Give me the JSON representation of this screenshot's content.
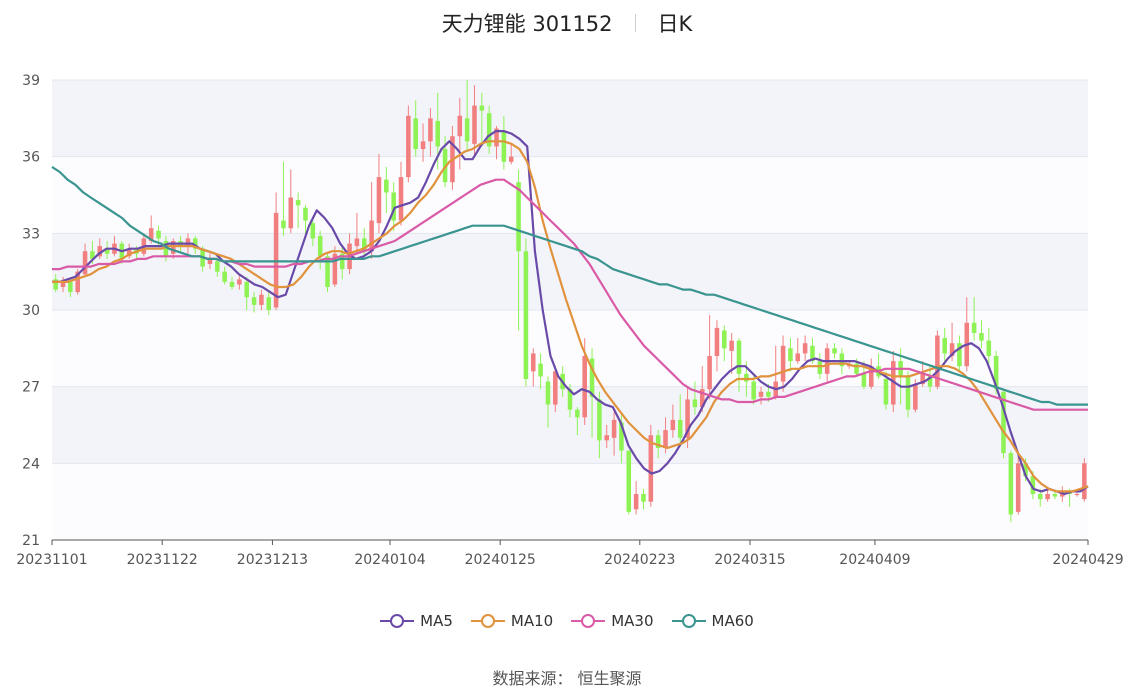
{
  "header": {
    "title": "天力锂能 301152",
    "period": "日K"
  },
  "footer": {
    "source": "数据来源：  恒生聚源"
  },
  "colors": {
    "up": "#f27f7f",
    "down": "#8ef255",
    "ma5": "#6a4aa8",
    "ma10": "#e0923c",
    "ma30": "#d95aa6",
    "ma60": "#3a9490",
    "band": "#f3f4fa",
    "grid": "#e4e6ef"
  },
  "chart_data": {
    "type": "candlestick",
    "ylim": [
      21,
      39
    ],
    "yticks": [
      "21",
      "24",
      "27",
      "30",
      "33",
      "36",
      "39"
    ],
    "xticks": [
      "20231101",
      "20231122",
      "20231213",
      "20240104",
      "20240125",
      "20240223",
      "20240315",
      "20240409",
      "20240429"
    ],
    "legend": [
      "MA5",
      "MA10",
      "MA30",
      "MA60"
    ],
    "grid": true,
    "legend_position": "bottom",
    "candles": [
      [
        31.2,
        30.8,
        31.4,
        30.7
      ],
      [
        30.9,
        31.1,
        31.3,
        30.7
      ],
      [
        31.1,
        30.7,
        31.2,
        30.5
      ],
      [
        30.7,
        31.5,
        31.6,
        30.6
      ],
      [
        31.4,
        32.3,
        32.6,
        31.3
      ],
      [
        32.3,
        32.0,
        32.7,
        31.8
      ],
      [
        32.1,
        32.5,
        32.8,
        32.0
      ],
      [
        32.4,
        32.2,
        32.7,
        32.0
      ],
      [
        32.2,
        32.6,
        32.9,
        32.1
      ],
      [
        32.6,
        32.0,
        32.7,
        31.8
      ],
      [
        32.1,
        32.4,
        32.6,
        32.0
      ],
      [
        32.4,
        32.2,
        32.5,
        32.0
      ],
      [
        32.2,
        32.8,
        33.0,
        32.1
      ],
      [
        32.7,
        33.2,
        33.7,
        32.6
      ],
      [
        33.1,
        32.8,
        33.3,
        32.5
      ],
      [
        32.7,
        32.1,
        32.9,
        31.9
      ],
      [
        32.2,
        32.7,
        32.8,
        32.0
      ],
      [
        32.7,
        32.5,
        32.9,
        32.3
      ],
      [
        32.5,
        32.8,
        33.0,
        32.2
      ],
      [
        32.8,
        32.4,
        32.9,
        32.2
      ],
      [
        32.4,
        31.7,
        32.5,
        31.5
      ],
      [
        31.8,
        32.0,
        32.2,
        31.6
      ],
      [
        31.9,
        31.5,
        32.1,
        31.3
      ],
      [
        31.5,
        31.1,
        31.7,
        31.0
      ],
      [
        31.1,
        30.9,
        31.3,
        30.8
      ],
      [
        31.0,
        31.2,
        31.4,
        30.8
      ],
      [
        31.1,
        30.5,
        31.3,
        30.0
      ],
      [
        30.5,
        30.2,
        30.7,
        29.9
      ],
      [
        30.2,
        30.6,
        30.8,
        30.0
      ],
      [
        30.5,
        30.0,
        30.7,
        29.8
      ],
      [
        30.1,
        33.8,
        34.6,
        30.0
      ],
      [
        33.5,
        33.2,
        35.8,
        32.9
      ],
      [
        33.2,
        34.4,
        35.5,
        33.0
      ],
      [
        34.3,
        34.1,
        34.6,
        33.2
      ],
      [
        34.0,
        33.5,
        34.1,
        32.8
      ],
      [
        33.4,
        32.8,
        33.5,
        32.5
      ],
      [
        32.9,
        32.1,
        33.1,
        31.6
      ],
      [
        32.1,
        30.9,
        32.2,
        30.7
      ],
      [
        31.0,
        32.2,
        32.5,
        30.9
      ],
      [
        32.2,
        31.6,
        32.5,
        31.2
      ],
      [
        31.6,
        32.6,
        33.0,
        31.4
      ],
      [
        32.5,
        32.8,
        33.8,
        32.2
      ],
      [
        32.8,
        32.3,
        33.2,
        32.1
      ],
      [
        32.3,
        33.5,
        35.0,
        32.0
      ],
      [
        33.4,
        35.2,
        36.1,
        33.0
      ],
      [
        35.1,
        34.6,
        35.6,
        33.8
      ],
      [
        34.6,
        33.5,
        35.0,
        33.1
      ],
      [
        33.5,
        35.2,
        35.8,
        33.3
      ],
      [
        35.2,
        37.6,
        38.0,
        35.0
      ],
      [
        37.5,
        36.3,
        38.2,
        36.0
      ],
      [
        36.3,
        36.6,
        37.3,
        35.8
      ],
      [
        36.6,
        37.5,
        37.9,
        36.0
      ],
      [
        37.4,
        36.4,
        38.5,
        35.5
      ],
      [
        36.3,
        35.0,
        36.8,
        34.8
      ],
      [
        35.0,
        36.8,
        37.2,
        34.7
      ],
      [
        36.8,
        37.6,
        38.3,
        35.5
      ],
      [
        37.5,
        36.6,
        39.0,
        36.2
      ],
      [
        36.5,
        38.0,
        38.8,
        36.0
      ],
      [
        38.0,
        37.8,
        38.5,
        36.5
      ],
      [
        37.7,
        36.4,
        38.0,
        36.1
      ],
      [
        36.4,
        37.1,
        37.2,
        35.9
      ],
      [
        37.0,
        35.8,
        37.6,
        35.5
      ],
      [
        35.8,
        36.0,
        36.5,
        35.7
      ],
      [
        35.0,
        32.3,
        35.5,
        29.2
      ],
      [
        32.3,
        27.3,
        32.8,
        27.0
      ],
      [
        27.6,
        28.3,
        28.5,
        27.0
      ],
      [
        27.9,
        27.4,
        28.3,
        26.9
      ],
      [
        27.2,
        26.3,
        27.4,
        25.4
      ],
      [
        26.3,
        27.6,
        27.8,
        26.0
      ],
      [
        27.5,
        26.9,
        27.8,
        26.6
      ],
      [
        26.9,
        26.1,
        27.1,
        25.8
      ],
      [
        26.1,
        25.8,
        26.2,
        25.1
      ],
      [
        25.8,
        28.2,
        28.9,
        25.5
      ],
      [
        28.1,
        26.6,
        28.5,
        25.0
      ],
      [
        26.5,
        24.9,
        26.8,
        24.2
      ],
      [
        24.9,
        25.1,
        25.5,
        24.6
      ],
      [
        25.0,
        25.7,
        26.0,
        24.3
      ],
      [
        25.6,
        24.5,
        25.9,
        24.0
      ],
      [
        24.5,
        22.1,
        24.5,
        22.0
      ],
      [
        22.2,
        22.8,
        23.3,
        22.0
      ],
      [
        22.8,
        22.5,
        23.0,
        22.2
      ],
      [
        22.5,
        25.1,
        25.5,
        22.3
      ],
      [
        25.1,
        24.6,
        25.3,
        24.2
      ],
      [
        24.6,
        25.3,
        25.8,
        24.4
      ],
      [
        25.3,
        25.7,
        26.3,
        25.0
      ],
      [
        25.7,
        25.0,
        26.7,
        24.8
      ],
      [
        25.0,
        26.5,
        27.0,
        24.6
      ],
      [
        26.5,
        26.2,
        27.2,
        25.9
      ],
      [
        26.2,
        26.9,
        27.8,
        26.0
      ],
      [
        26.9,
        28.2,
        29.8,
        26.5
      ],
      [
        28.2,
        29.3,
        29.6,
        27.6
      ],
      [
        29.2,
        28.5,
        29.4,
        28.0
      ],
      [
        28.4,
        28.8,
        29.1,
        27.5
      ],
      [
        28.8,
        27.5,
        28.9,
        26.8
      ],
      [
        27.5,
        27.2,
        28.0,
        26.6
      ],
      [
        27.2,
        26.5,
        27.4,
        26.3
      ],
      [
        26.6,
        26.8,
        27.0,
        26.3
      ],
      [
        26.8,
        26.6,
        27.1,
        26.4
      ],
      [
        26.6,
        27.2,
        28.6,
        26.5
      ],
      [
        27.2,
        28.6,
        29.0,
        26.8
      ],
      [
        28.5,
        28.0,
        28.9,
        27.6
      ],
      [
        28.0,
        28.3,
        28.9,
        27.9
      ],
      [
        28.3,
        28.7,
        29.0,
        28.0
      ],
      [
        28.6,
        28.0,
        28.9,
        27.9
      ],
      [
        28.0,
        27.5,
        28.3,
        27.3
      ],
      [
        27.5,
        28.5,
        28.7,
        27.2
      ],
      [
        28.5,
        28.3,
        28.7,
        28.1
      ],
      [
        28.3,
        27.8,
        28.5,
        27.5
      ],
      [
        27.8,
        27.9,
        28.0,
        27.7
      ],
      [
        27.9,
        27.5,
        28.1,
        27.4
      ],
      [
        27.5,
        27.0,
        28.0,
        26.9
      ],
      [
        27.0,
        27.8,
        28.1,
        26.9
      ],
      [
        27.8,
        27.4,
        28.3,
        27.3
      ],
      [
        27.3,
        26.3,
        27.6,
        26.1
      ],
      [
        26.3,
        28.0,
        28.4,
        26.0
      ],
      [
        28.0,
        27.4,
        28.5,
        26.3
      ],
      [
        27.4,
        26.1,
        27.6,
        25.8
      ],
      [
        26.1,
        27.1,
        27.3,
        26.0
      ],
      [
        27.1,
        27.5,
        28.0,
        27.0
      ],
      [
        27.4,
        27.0,
        27.8,
        26.8
      ],
      [
        27.0,
        29.0,
        29.2,
        26.9
      ],
      [
        28.9,
        28.3,
        29.3,
        28.0
      ],
      [
        28.2,
        28.7,
        29.5,
        28.0
      ],
      [
        28.7,
        27.8,
        29.0,
        27.6
      ],
      [
        27.8,
        29.5,
        30.5,
        27.6
      ],
      [
        29.5,
        29.1,
        30.5,
        28.8
      ],
      [
        29.1,
        28.8,
        29.6,
        28.5
      ],
      [
        28.8,
        28.2,
        29.3,
        27.9
      ],
      [
        28.2,
        26.9,
        28.4,
        26.7
      ],
      [
        26.8,
        24.4,
        26.9,
        24.2
      ],
      [
        24.4,
        22.0,
        24.5,
        21.7
      ],
      [
        22.1,
        24.0,
        24.3,
        22.0
      ],
      [
        24.0,
        23.5,
        24.2,
        23.3
      ],
      [
        23.5,
        22.8,
        23.7,
        22.6
      ],
      [
        22.8,
        22.6,
        23.0,
        22.3
      ],
      [
        22.6,
        22.8,
        23.0,
        22.5
      ],
      [
        22.8,
        22.7,
        22.9,
        22.6
      ],
      [
        22.7,
        22.9,
        23.1,
        22.5
      ],
      [
        22.9,
        22.8,
        23.0,
        22.3
      ],
      [
        22.8,
        22.8,
        23.0,
        22.7
      ],
      [
        22.6,
        24.0,
        24.2,
        22.5
      ]
    ],
    "series": [
      {
        "name": "MA5",
        "values": [
          31.1,
          31.1,
          31.2,
          31.3,
          31.6,
          31.9,
          32.2,
          32.4,
          32.4,
          32.3,
          32.4,
          32.4,
          32.5,
          32.5,
          32.5,
          32.6,
          32.6,
          32.6,
          32.6,
          32.4,
          32.3,
          32.2,
          31.9,
          31.7,
          31.4,
          31.2,
          31.0,
          30.9,
          30.7,
          30.5,
          30.6,
          31.5,
          32.4,
          33.3,
          33.9,
          33.6,
          33.2,
          32.6,
          32.2,
          32.0,
          32.1,
          32.3,
          32.7,
          33.3,
          34.0,
          34.1,
          34.2,
          34.4,
          35.0,
          35.7,
          36.3,
          36.6,
          36.3,
          35.9,
          35.9,
          36.4,
          36.8,
          37.0,
          37.0,
          36.9,
          36.7,
          36.4,
          32.3,
          30.0,
          28.2,
          27.4,
          27.0,
          26.7,
          26.9,
          26.8,
          26.5,
          26.3,
          26.2,
          25.6,
          24.7,
          24.2,
          23.8,
          23.6,
          23.7,
          24.0,
          24.4,
          24.9,
          25.5,
          25.9,
          26.5,
          26.9,
          27.3,
          27.6,
          27.8,
          27.8,
          27.5,
          27.2,
          27.0,
          26.9,
          27.0,
          27.3,
          27.7,
          28.0,
          28.1,
          28.0,
          28.0,
          28.0,
          28.0,
          28.0,
          27.9,
          27.8,
          27.6,
          27.4,
          27.2,
          27.0,
          27.0,
          27.1,
          27.2,
          27.4,
          27.7,
          28.1,
          28.4,
          28.6,
          28.7,
          28.5,
          28.0,
          27.2,
          26.3,
          25.3,
          24.4,
          23.5,
          23.0,
          22.9,
          23.0,
          22.9,
          22.8,
          22.9,
          22.9,
          23.1
        ]
      },
      {
        "name": "MA10",
        "values": [
          31.1,
          31.1,
          31.1,
          31.2,
          31.3,
          31.4,
          31.6,
          31.7,
          31.9,
          32.0,
          32.2,
          32.3,
          32.4,
          32.4,
          32.4,
          32.5,
          32.5,
          32.5,
          32.5,
          32.4,
          32.3,
          32.2,
          32.1,
          32.0,
          31.8,
          31.6,
          31.4,
          31.2,
          31.0,
          30.9,
          30.9,
          31.0,
          31.3,
          31.7,
          32.0,
          32.2,
          32.3,
          32.3,
          32.2,
          32.3,
          32.4,
          32.6,
          32.8,
          33.0,
          33.3,
          33.5,
          33.8,
          34.2,
          34.5,
          34.9,
          35.4,
          35.8,
          36.0,
          36.2,
          36.3,
          36.5,
          36.6,
          36.6,
          36.6,
          36.5,
          36.3,
          35.8,
          34.8,
          33.5,
          32.4,
          31.4,
          30.4,
          29.5,
          28.6,
          27.9,
          27.3,
          26.8,
          26.4,
          26.0,
          25.6,
          25.3,
          25.0,
          24.8,
          24.7,
          24.6,
          24.7,
          24.8,
          25.0,
          25.4,
          25.8,
          26.4,
          26.8,
          27.1,
          27.3,
          27.3,
          27.3,
          27.4,
          27.4,
          27.5,
          27.6,
          27.7,
          27.7,
          27.8,
          27.8,
          27.8,
          27.9,
          27.9,
          27.9,
          27.8,
          27.8,
          27.7,
          27.6,
          27.5,
          27.4,
          27.4,
          27.4,
          27.5,
          27.6,
          27.7,
          27.8,
          27.8,
          27.7,
          27.5,
          27.2,
          26.8,
          26.3,
          25.8,
          25.3,
          24.9,
          24.4,
          24.0,
          23.5,
          23.2,
          23.0,
          22.9,
          22.9,
          22.9,
          23.0,
          23.1
        ]
      },
      {
        "name": "MA30",
        "values": [
          31.6,
          31.6,
          31.7,
          31.7,
          31.7,
          31.7,
          31.8,
          31.8,
          31.8,
          31.9,
          31.9,
          32.0,
          32.0,
          32.1,
          32.1,
          32.1,
          32.1,
          32.1,
          32.1,
          32.1,
          32.0,
          32.0,
          31.9,
          31.9,
          31.8,
          31.8,
          31.7,
          31.7,
          31.7,
          31.7,
          31.7,
          31.8,
          31.8,
          31.9,
          31.9,
          32.0,
          32.0,
          32.1,
          32.1,
          32.2,
          32.3,
          32.4,
          32.5,
          32.6,
          32.7,
          32.9,
          33.1,
          33.3,
          33.5,
          33.7,
          33.9,
          34.1,
          34.3,
          34.5,
          34.7,
          34.9,
          35.0,
          35.1,
          35.1,
          34.9,
          34.7,
          34.4,
          34.1,
          33.8,
          33.5,
          33.2,
          32.9,
          32.6,
          32.2,
          31.8,
          31.3,
          30.8,
          30.3,
          29.8,
          29.4,
          29.0,
          28.6,
          28.3,
          28.0,
          27.7,
          27.4,
          27.1,
          26.9,
          26.8,
          26.7,
          26.6,
          26.5,
          26.5,
          26.4,
          26.4,
          26.4,
          26.5,
          26.5,
          26.6,
          26.6,
          26.7,
          26.8,
          26.9,
          27.0,
          27.1,
          27.2,
          27.3,
          27.4,
          27.4,
          27.5,
          27.6,
          27.6,
          27.7,
          27.7,
          27.7,
          27.7,
          27.6,
          27.5,
          27.4,
          27.3,
          27.2,
          27.1,
          27.0,
          26.9,
          26.8,
          26.7,
          26.6,
          26.5,
          26.4,
          26.3,
          26.2,
          26.1,
          26.1,
          26.1,
          26.1,
          26.1,
          26.1,
          26.1,
          26.1
        ]
      },
      {
        "name": "MA60",
        "values": [
          35.6,
          35.4,
          35.1,
          34.9,
          34.6,
          34.4,
          34.2,
          34.0,
          33.8,
          33.6,
          33.3,
          33.1,
          32.9,
          32.7,
          32.6,
          32.4,
          32.3,
          32.2,
          32.1,
          32.1,
          32.0,
          32.0,
          31.9,
          31.9,
          31.9,
          31.9,
          31.9,
          31.9,
          31.9,
          31.9,
          31.9,
          31.9,
          31.9,
          31.9,
          31.9,
          31.9,
          31.9,
          32.0,
          32.0,
          32.0,
          32.0,
          32.1,
          32.1,
          32.2,
          32.3,
          32.4,
          32.5,
          32.6,
          32.7,
          32.8,
          32.9,
          33.0,
          33.1,
          33.2,
          33.3,
          33.3,
          33.3,
          33.3,
          33.3,
          33.2,
          33.1,
          33.0,
          32.9,
          32.8,
          32.7,
          32.6,
          32.5,
          32.4,
          32.3,
          32.1,
          32.0,
          31.8,
          31.6,
          31.5,
          31.4,
          31.3,
          31.2,
          31.1,
          31.0,
          31.0,
          30.9,
          30.8,
          30.8,
          30.7,
          30.6,
          30.6,
          30.5,
          30.4,
          30.3,
          30.2,
          30.1,
          30.0,
          29.9,
          29.8,
          29.7,
          29.6,
          29.5,
          29.4,
          29.3,
          29.2,
          29.1,
          29.0,
          28.9,
          28.8,
          28.7,
          28.6,
          28.5,
          28.4,
          28.3,
          28.2,
          28.1,
          28.0,
          27.9,
          27.8,
          27.7,
          27.6,
          27.5,
          27.4,
          27.3,
          27.2,
          27.1,
          27.0,
          26.9,
          26.8,
          26.7,
          26.6,
          26.5,
          26.4,
          26.4,
          26.3,
          26.3,
          26.3,
          26.3,
          26.3
        ]
      }
    ]
  }
}
